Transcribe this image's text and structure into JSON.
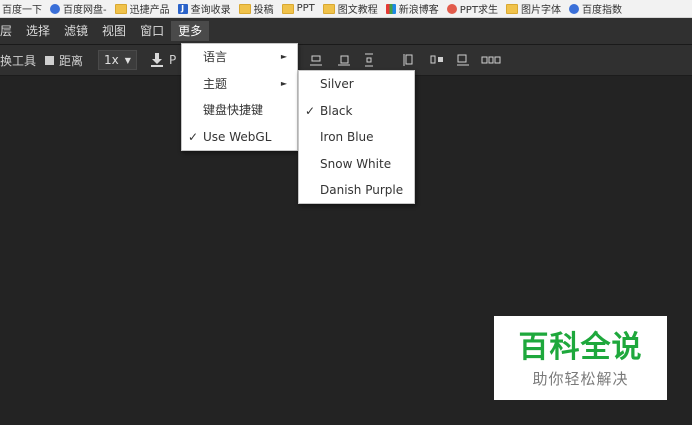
{
  "bookmarks": [
    {
      "label": "百度一下",
      "icon": "paw-icon"
    },
    {
      "label": "百度网盘-",
      "icon": "cloud-icon"
    },
    {
      "label": "迅捷产品",
      "icon": "folder-icon"
    },
    {
      "label": "查询收录",
      "icon": "j-icon"
    },
    {
      "label": "投稿",
      "icon": "folder-icon"
    },
    {
      "label": "PPT",
      "icon": "folder-icon"
    },
    {
      "label": "图文教程",
      "icon": "folder-icon"
    },
    {
      "label": "新浪博客",
      "icon": "colorful-icon"
    },
    {
      "label": "PPT求生",
      "icon": "ppt-icon"
    },
    {
      "label": "图片字体",
      "icon": "folder-icon"
    },
    {
      "label": "百度指数",
      "icon": "paw-icon"
    }
  ],
  "menubar": {
    "items": [
      "层",
      "选择",
      "滤镜",
      "视图",
      "窗口",
      "更多"
    ],
    "active": "更多"
  },
  "toolbar": {
    "tool_label": "换工具",
    "distance_label": "距离",
    "zoom_value": "1x",
    "export_label": "P"
  },
  "more_menu": {
    "items": [
      {
        "label": "语言",
        "checked": false,
        "submenu": true
      },
      {
        "label": "主题",
        "checked": false,
        "submenu": true
      },
      {
        "label": "键盘快捷键",
        "checked": false,
        "submenu": false
      },
      {
        "label": "Use WebGL",
        "checked": true,
        "submenu": false
      }
    ]
  },
  "theme_menu": {
    "items": [
      {
        "label": "Silver",
        "checked": false
      },
      {
        "label": "Black",
        "checked": true
      },
      {
        "label": "Iron Blue",
        "checked": false
      },
      {
        "label": "Snow White",
        "checked": false
      },
      {
        "label": "Danish Purple",
        "checked": false
      }
    ]
  },
  "check_mark": "✓",
  "watermark": {
    "title": "百科全说",
    "subtitle": "助你轻松解决"
  }
}
